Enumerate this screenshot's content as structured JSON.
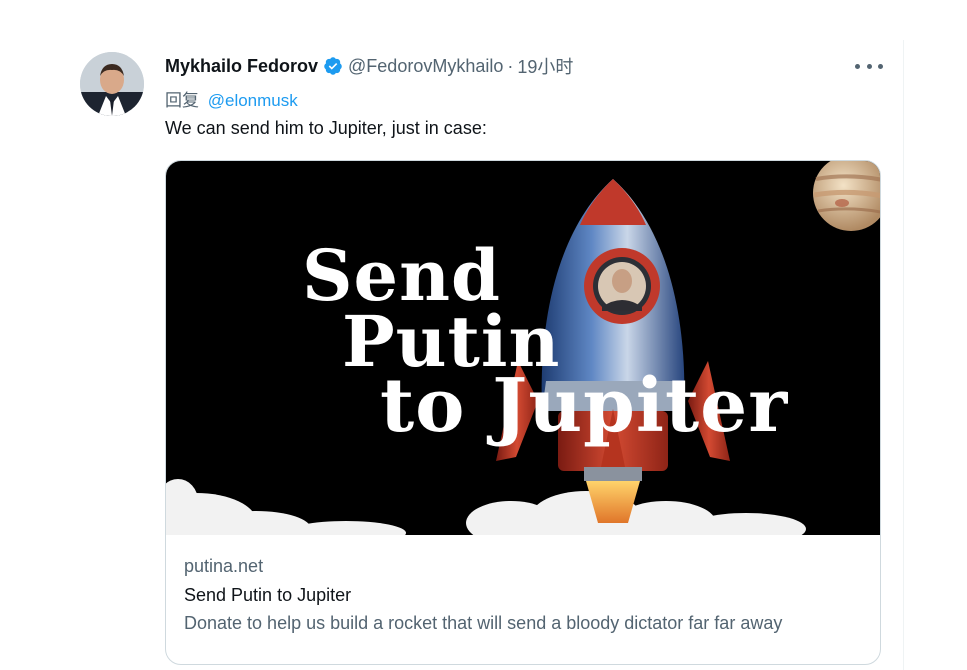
{
  "tweet": {
    "author": {
      "name": "Mykhailo Fedorov",
      "handle": "@FedorovMykhailo",
      "verified": true,
      "avatar_icon": "person-avatar"
    },
    "separator": "·",
    "timestamp": "19小时",
    "more_icon": "more-dots-icon",
    "reply": {
      "label": "回复",
      "mention": "@elonmusk"
    },
    "text": "We can send him to Jupiter, just in case:"
  },
  "card": {
    "image": {
      "headline": [
        "Send",
        "Putin",
        "to Jupiter"
      ],
      "elements": [
        "rocket",
        "porthole-portrait",
        "jupiter-planet",
        "smoke-clouds"
      ]
    },
    "domain": "putina.net",
    "title": "Send Putin to Jupiter",
    "description": "Donate to help us build a rocket that will send a bloody dictator far far away"
  },
  "colors": {
    "text_primary": "#0f1419",
    "text_secondary": "#536471",
    "link": "#1d9bf0",
    "verified_badge": "#1d9bf0",
    "card_border": "#cfd9de",
    "rocket_red": "#c0392b",
    "rocket_blue": "#2f5f9e"
  }
}
